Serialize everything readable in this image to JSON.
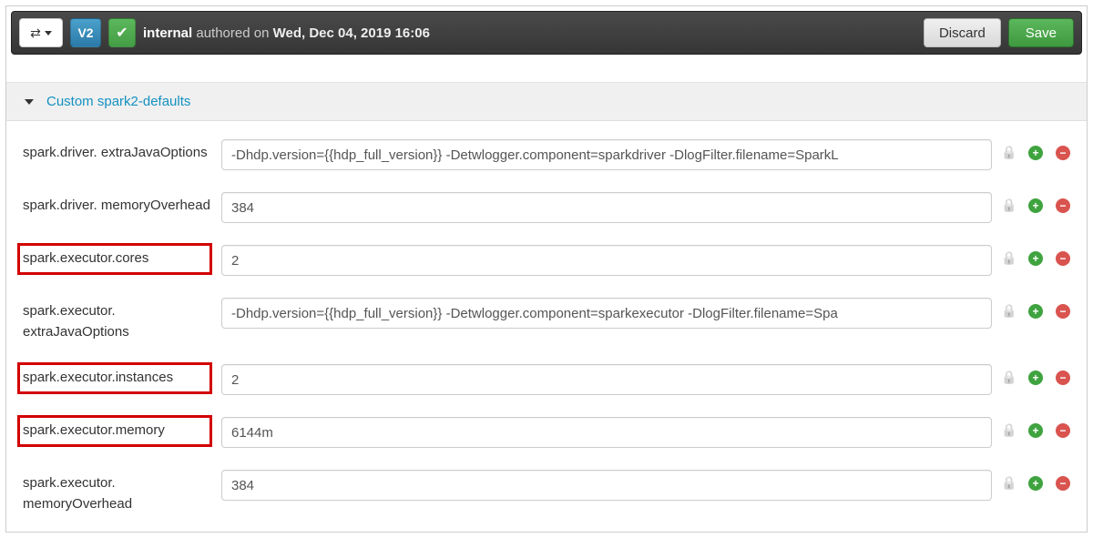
{
  "toolbar": {
    "version_badge": "V2",
    "user": "internal",
    "authored_word": "authored on",
    "timestamp": "Wed, Dec 04, 2019 16:06",
    "discard_label": "Discard",
    "save_label": "Save"
  },
  "section": {
    "title": "Custom spark2-defaults"
  },
  "rows": [
    {
      "label": "spark.driver. extraJavaOptions",
      "value": "-Dhdp.version={{hdp_full_version}} -Detwlogger.component=sparkdriver -DlogFilter.filename=SparkL",
      "highlight": false
    },
    {
      "label": "spark.driver. memoryOverhead",
      "value": "384",
      "highlight": false
    },
    {
      "label": "spark.executor.cores",
      "value": "2",
      "highlight": true
    },
    {
      "label": "spark.executor. extraJavaOptions",
      "value": "-Dhdp.version={{hdp_full_version}} -Detwlogger.component=sparkexecutor -DlogFilter.filename=Spa",
      "highlight": false
    },
    {
      "label": "spark.executor.instances",
      "value": "2",
      "highlight": true
    },
    {
      "label": "spark.executor.memory",
      "value": "6144m",
      "highlight": true
    },
    {
      "label": "spark.executor. memoryOverhead",
      "value": "384",
      "highlight": false
    }
  ]
}
